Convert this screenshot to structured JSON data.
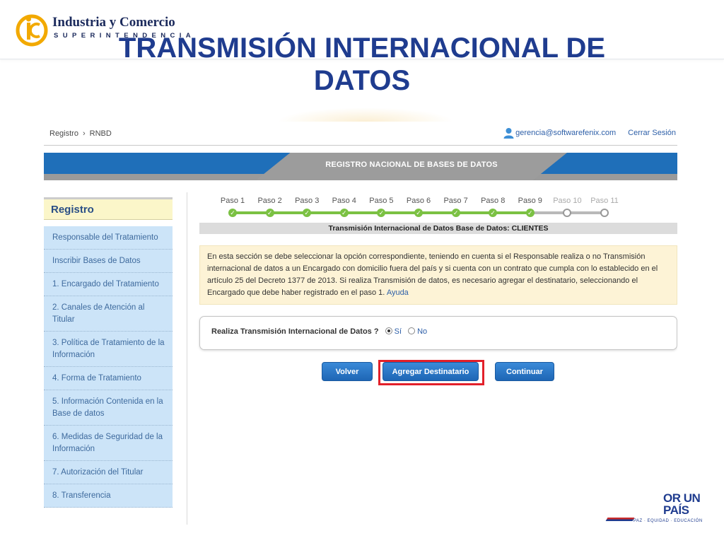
{
  "slide": {
    "logo_line1": "Industria y Comercio",
    "logo_line2": "SUPERINTENDENCIA",
    "title_line1": "TRANSMISIÓN INTERNACIONAL DE",
    "title_line2": "DATOS"
  },
  "header": {
    "breadcrumb": [
      "Registro",
      "RNBD"
    ],
    "breadcrumb_sep": "›",
    "user_email": "gerencia@softwarefenix.com",
    "logout": "Cerrar Sesión"
  },
  "banner": {
    "title": "REGISTRO NACIONAL DE BASES DE DATOS"
  },
  "sidebar": {
    "title": "Registro",
    "items": [
      {
        "label": "Responsable del Tratamiento"
      },
      {
        "label": "Inscribir Bases de Datos"
      },
      {
        "label": "1. Encargado del Tratamiento"
      },
      {
        "label": "2. Canales de Atención al Titular"
      },
      {
        "label": "3. Política de Tratamiento de la Información"
      },
      {
        "label": "4. Forma de Tratamiento"
      },
      {
        "label": "5. Información Contenida en la Base de datos"
      },
      {
        "label": "6. Medidas de Seguridad de la Información"
      },
      {
        "label": "7. Autorización del Titular"
      },
      {
        "label": "8. Transferencia"
      }
    ]
  },
  "steps": [
    {
      "label": "Paso 1",
      "done": true
    },
    {
      "label": "Paso 2",
      "done": true
    },
    {
      "label": "Paso 3",
      "done": true
    },
    {
      "label": "Paso 4",
      "done": true
    },
    {
      "label": "Paso 5",
      "done": true
    },
    {
      "label": "Paso 6",
      "done": true
    },
    {
      "label": "Paso 7",
      "done": true
    },
    {
      "label": "Paso 8",
      "done": true
    },
    {
      "label": "Paso 9",
      "done": true
    },
    {
      "label": "Paso 10",
      "done": false
    },
    {
      "label": "Paso 11",
      "done": false
    }
  ],
  "section": {
    "title": "Transmisión Internacional de Datos Base de Datos: CLIENTES"
  },
  "info": {
    "text": "En esta sección se debe seleccionar la opción correspondiente, teniendo en cuenta si el Responsable realiza o no Transmisión internacional de datos a un Encargado con domicilio fuera del país y si cuenta con un contrato que cumpla con lo establecido en el artículo 25 del Decreto 1377 de 2013. Si realiza Transmisión de datos, es necesario agregar el destinatario, seleccionando el Encargado que debe haber registrado en el paso 1.",
    "link": "Ayuda"
  },
  "question": {
    "text": "Realiza Transmisión Internacional de Datos ?",
    "option_yes": "Sí",
    "option_no": "No",
    "selected": "Sí"
  },
  "buttons": {
    "back": "Volver",
    "add_recipient": "Agregar Destinatario",
    "continue": "Continuar"
  },
  "footer_logo": {
    "line1": "OR UN",
    "line2": "PAÍS",
    "line3": "PAZ · EQUIDAD · EDUCACIÓN"
  }
}
